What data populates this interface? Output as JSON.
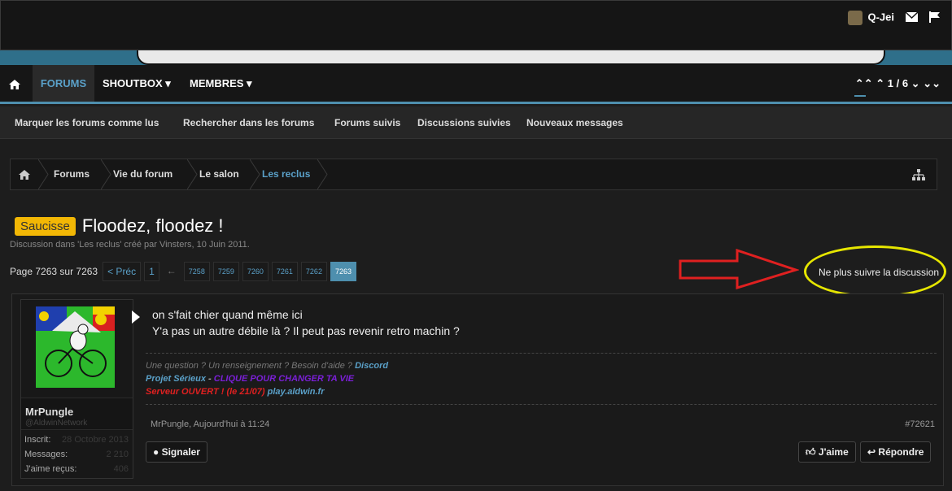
{
  "topbar": {
    "username": "Q-Jei",
    "mail_icon": "mail-icon",
    "flag_icon": "flag-icon"
  },
  "nav": {
    "forums": "FORUMS",
    "shoutbox": "SHOUTBOX ▾",
    "membres": "MEMBRES ▾",
    "pager": "1 / 6"
  },
  "subnav": {
    "items": [
      "Marquer les forums comme lus",
      "Rechercher dans les forums",
      "Forums suivis",
      "Discussions suivies",
      "Nouveaux messages"
    ]
  },
  "breadcrumb": {
    "items": [
      "Forums",
      "Vie du forum",
      "Le salon",
      "Les reclus"
    ]
  },
  "thread": {
    "prefix": "Saucisse",
    "title": "Floodez, floodez !",
    "meta": "Discussion dans 'Les reclus' créé par Vinsters, 10 Juin 2011.",
    "page_label": "Page 7263 sur 7263",
    "prev": "< Préc",
    "first_page": "1",
    "ellipsis": "←",
    "pages": [
      "7258",
      "7259",
      "7260",
      "7261",
      "7262",
      "7263"
    ],
    "unfollow": "Ne plus suivre la discussion"
  },
  "post": {
    "author": "MrPungle",
    "author_title": "@AldwinNetwork",
    "stats": [
      {
        "label": "Inscrit:",
        "value": "28 Octobre 2013"
      },
      {
        "label": "Messages:",
        "value": "2 210"
      },
      {
        "label": "J'aime reçus:",
        "value": "406"
      }
    ],
    "lines": [
      "on s'fait chier quand même ici",
      "Y'a pas un autre débile là ? Il peut pas revenir retro machin ?"
    ],
    "sig": {
      "line1_text": "Une question ? Un renseignement ? Besoin d'aide ? ",
      "line1_link": "Discord",
      "line2_a": "Projet Sérieux",
      "line2_b": " - ",
      "line2_c": "CLIQUE POUR CHANGER TA VIE",
      "line3_a": "Serveur OUVERT ! (le 21/07) ",
      "line3_b": "play.aldwin.fr"
    },
    "meta": "MrPungle, Aujourd'hui à 11:24",
    "number": "#72621",
    "report": "Signaler",
    "like": "J'aime",
    "reply": "Répondre"
  },
  "colors": {
    "accent": "#4e8fae",
    "prefix": "#f2b705",
    "highlight": "#e6e600",
    "arrow": "#e02020"
  }
}
